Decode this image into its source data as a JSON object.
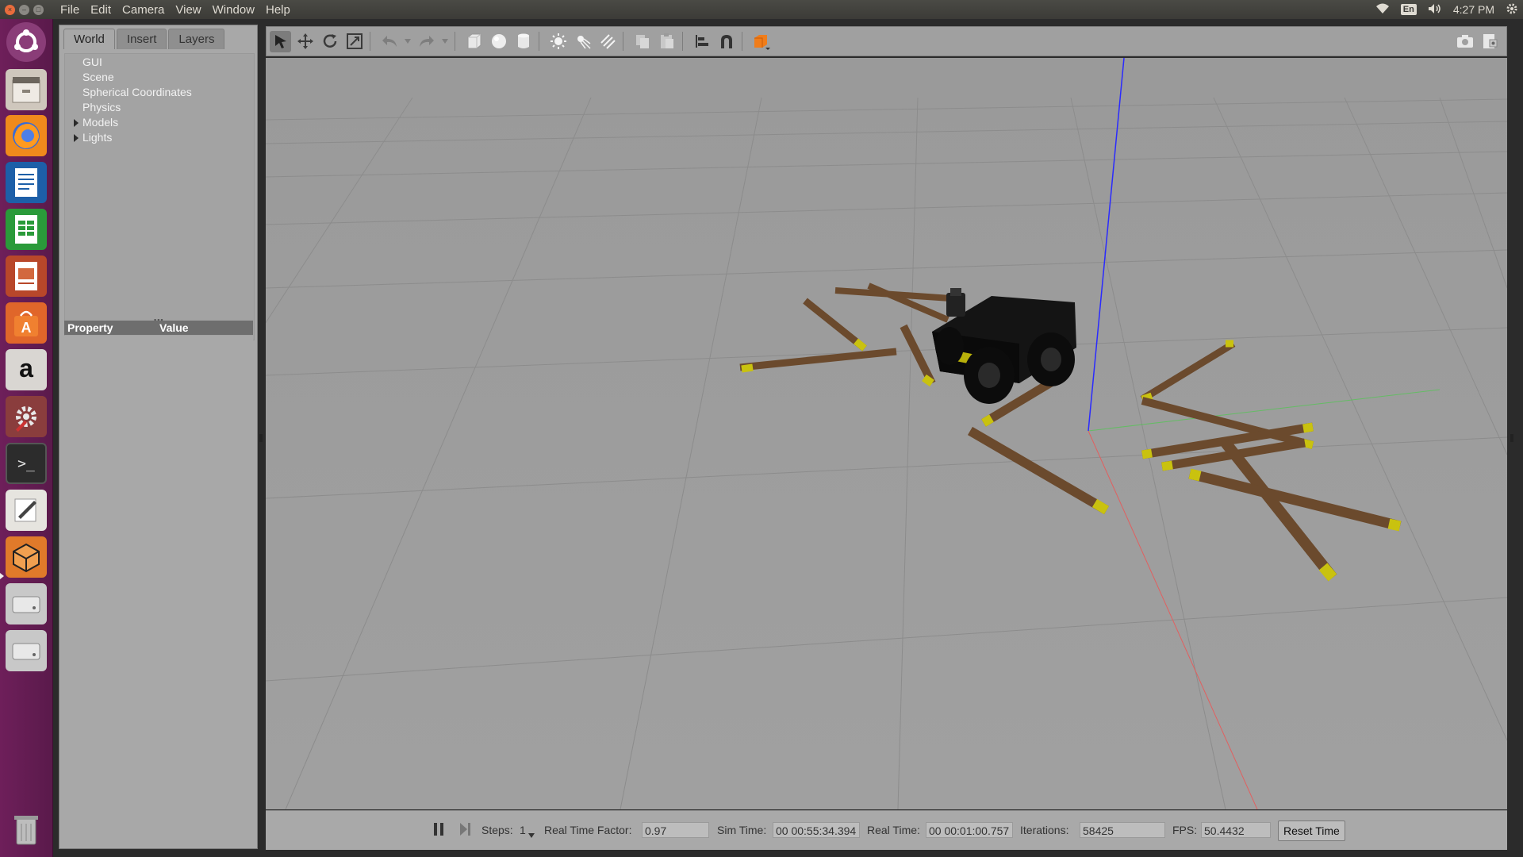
{
  "menubar": {
    "window_buttons": {
      "close_symbol": "×",
      "min_symbol": "–",
      "max_symbol": "□"
    },
    "items": [
      "File",
      "Edit",
      "Camera",
      "View",
      "Window",
      "Help"
    ],
    "tray": {
      "wifi_icon": "wifi-icon",
      "keyboard_layout": "En",
      "volume_icon": "volume-icon",
      "clock": "4:27 PM",
      "settings_icon": "gear-icon"
    }
  },
  "launcher": {
    "apps": [
      {
        "name": "ubuntu-dash-icon"
      },
      {
        "name": "files-icon"
      },
      {
        "name": "firefox-icon"
      },
      {
        "name": "libreoffice-writer-icon"
      },
      {
        "name": "libreoffice-calc-icon"
      },
      {
        "name": "libreoffice-impress-icon"
      },
      {
        "name": "software-center-icon"
      },
      {
        "name": "amazon-icon",
        "glyph": "a"
      },
      {
        "name": "system-settings-icon"
      },
      {
        "name": "terminal-icon",
        "glyph": ">_"
      },
      {
        "name": "text-editor-icon"
      },
      {
        "name": "gazebo-icon"
      },
      {
        "name": "drive-icon"
      },
      {
        "name": "drive-icon-2"
      },
      {
        "name": "trash-icon"
      }
    ]
  },
  "left_panel": {
    "tabs": [
      "World",
      "Insert",
      "Layers"
    ],
    "active_tab": "World",
    "tree": [
      "GUI",
      "Scene",
      "Spherical Coordinates",
      "Physics",
      "Models",
      "Lights"
    ],
    "expandable": [
      "Models",
      "Lights"
    ],
    "property_header": {
      "property": "Property",
      "value": "Value"
    }
  },
  "toolbar": {
    "tools": [
      "select-mode-icon",
      "translate-mode-icon",
      "rotate-mode-icon",
      "scale-mode-icon",
      "undo-icon",
      "redo-icon",
      "box-icon",
      "sphere-icon",
      "cylinder-icon",
      "point-light-icon",
      "spot-light-icon",
      "directional-light-icon",
      "copy-icon",
      "paste-icon",
      "align-icon",
      "snap-icon",
      "view-angle-icon",
      "screenshot-icon",
      "log-icon"
    ],
    "active_tool": "select-mode-icon"
  },
  "statusbar": {
    "steps_label": "Steps:",
    "steps_value": "1",
    "rtf_label": "Real Time Factor:",
    "rtf_value": "0.97",
    "sim_time_label": "Sim Time:",
    "sim_time_value": "00 00:55:34.394",
    "real_time_label": "Real Time:",
    "real_time_value": "00 00:01:00.757",
    "iterations_label": "Iterations:",
    "iterations_value": "58425",
    "fps_label": "FPS:",
    "fps_value": "50.4432",
    "reset_label": "Reset Time"
  },
  "colors": {
    "launcher_bg": "#6e1f5a",
    "viewport_bg": "#9b9b9b",
    "panel_bg": "#a8a8a8",
    "plank_wood": "#6b4a2d",
    "plank_cap": "#c9c20f",
    "robot_body": "#111111",
    "axis_z": "#2a2aff",
    "axis_x": "#e06060",
    "axis_y": "#40d040"
  }
}
